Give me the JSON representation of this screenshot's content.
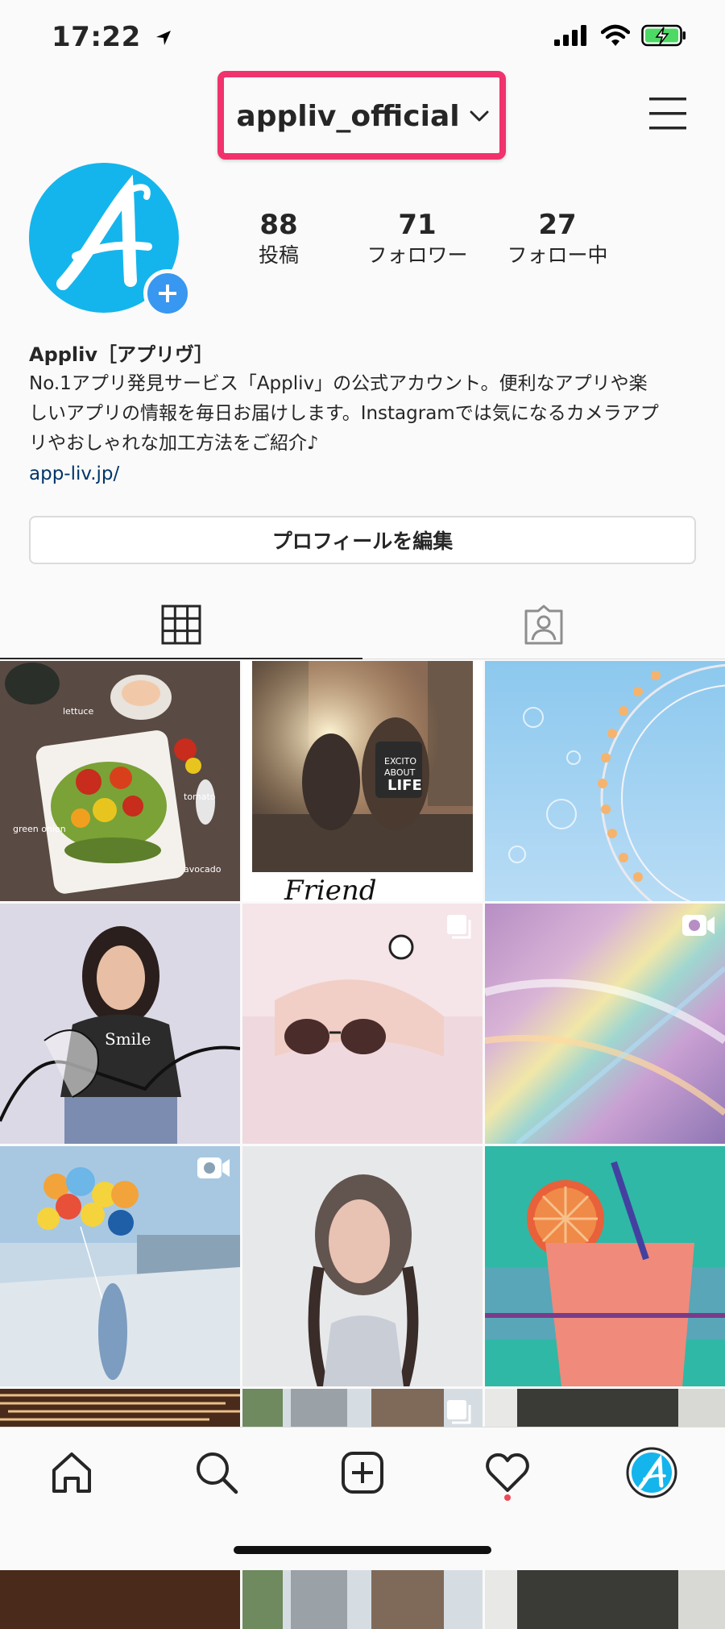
{
  "status_bar": {
    "time": "17:22"
  },
  "header": {
    "username": "appliv_official"
  },
  "profile": {
    "stats": [
      {
        "value": "88",
        "label": "投稿"
      },
      {
        "value": "71",
        "label": "フォロワー"
      },
      {
        "value": "27",
        "label": "フォロー中"
      }
    ],
    "name": "Appliv［アプリヴ］",
    "bio_lines": [
      "No.1アプリ発見サービス「Appliv」の公式アカウント。便利なアプリや楽",
      "しいアプリの情報を毎日お届けします。Instagramでは気になるカメラアプ",
      "リやおしゃれな加工方法をご紹介♪"
    ],
    "link": "app-liv.jp/",
    "edit_button": "プロフィールを編集"
  },
  "post_labels": {
    "food": [
      "lettuce",
      "tomato",
      "green onion",
      "avocado"
    ],
    "girls_bag": [
      "EXCITO",
      "ABOUT",
      "LIFE"
    ],
    "girls_caption": "Friend",
    "smile_shirt": "Smile"
  },
  "colors": {
    "brand_blue": "#14b5ec",
    "highlight": "#f0336c",
    "link": "#003569",
    "notification_dot": "#ed4956"
  },
  "icons": {
    "tabs": [
      "grid-icon",
      "tagged-person-icon"
    ],
    "nav": [
      "home-icon",
      "search-icon",
      "add-post-icon",
      "heart-icon",
      "profile-avatar-icon"
    ]
  }
}
